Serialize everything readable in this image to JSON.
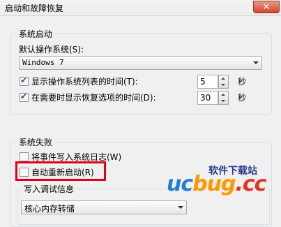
{
  "window": {
    "title": "启动和故障恢复",
    "close_symbol": "✕"
  },
  "system_startup": {
    "group_label": "系统启动",
    "default_os_label": "默认操作系统(S):",
    "default_os_value": "Windows 7",
    "show_os_list": {
      "checked": true,
      "label": "显示操作系统列表的时间(T):",
      "value": "5",
      "unit": "秒"
    },
    "show_recovery": {
      "checked": true,
      "label": "在需要时显示恢复选项的时间(D):",
      "value": "30",
      "unit": "秒"
    }
  },
  "system_failure": {
    "group_label": "系统失败",
    "write_event_log": {
      "checked": false,
      "label": "将事件写入系统日志(W)"
    },
    "auto_restart": {
      "checked": false,
      "label": "自动重新启动(R)"
    },
    "debug_info": {
      "group_label": "写入调试信息",
      "selected": "核心内存转储"
    }
  },
  "watermark": {
    "tagline": "软件下载站",
    "logo_part1": "uc",
    "logo_part2": "bug",
    "logo_part3": ".cc"
  },
  "colors": {
    "highlight_border": "#e0001a",
    "close_button": "#d2452a"
  }
}
